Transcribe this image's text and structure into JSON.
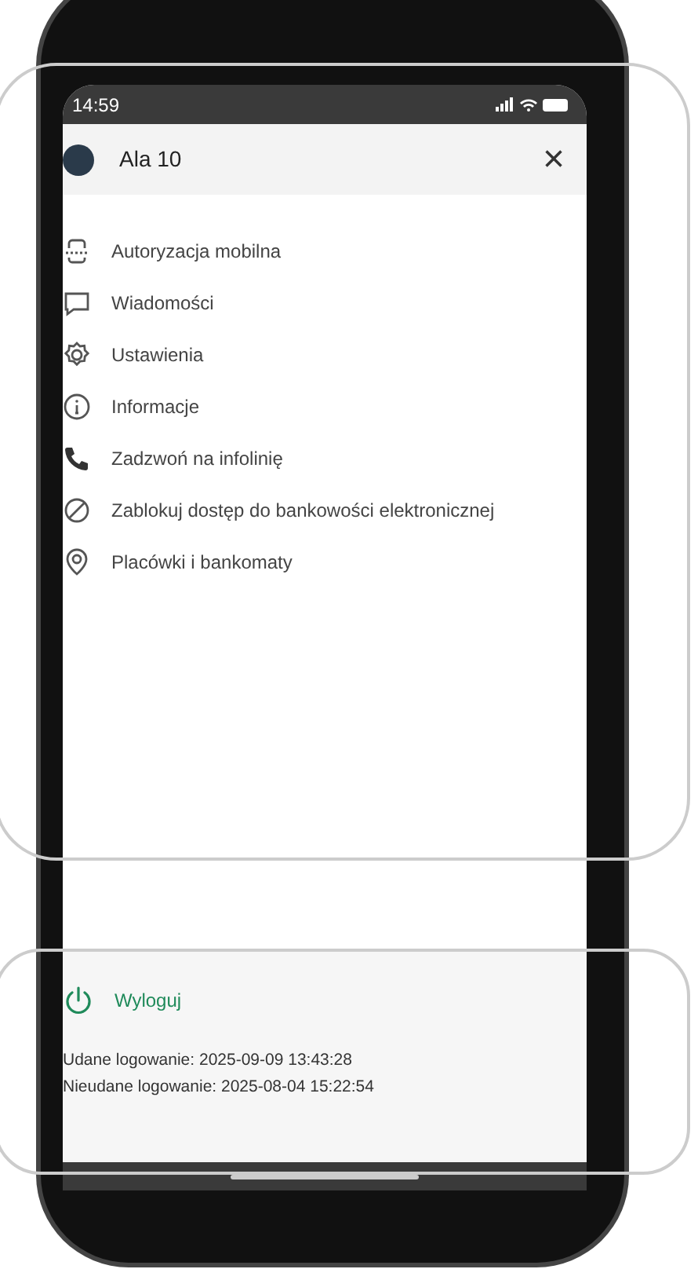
{
  "status_bar": {
    "time": "14:59"
  },
  "header": {
    "user_name": "Ala 10",
    "close": "×"
  },
  "menu": [
    {
      "kind": "mobile-auth",
      "label": "Autoryzacja mobilna"
    },
    {
      "kind": "message",
      "label": "Wiadomości"
    },
    {
      "kind": "settings",
      "label": "Ustawienia"
    },
    {
      "kind": "info",
      "label": "Informacje"
    },
    {
      "kind": "phone",
      "label": "Zadzwoń na infolinię"
    },
    {
      "kind": "block",
      "label": "Zablokuj dostęp do bankowości elektronicznej"
    },
    {
      "kind": "location",
      "label": "Placówki i bankomaty"
    }
  ],
  "footer": {
    "logout": "Wyloguj",
    "last_logins": [
      "Udane logowanie: 2025-09-09 13:43:28",
      "Nieudane logowanie: 2025-08-04 15:22:54"
    ]
  }
}
